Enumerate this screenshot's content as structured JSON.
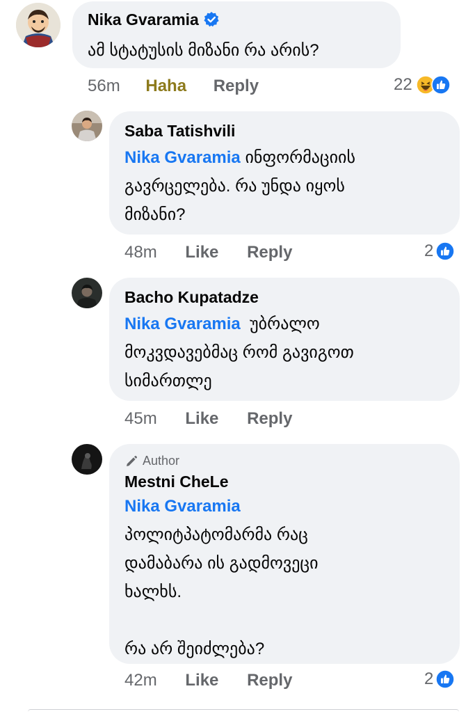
{
  "comments": [
    {
      "author": "Nika Gvaramia",
      "verified": true,
      "text": "ამ სტატუსის მიზანი რა არის?",
      "time": "56m",
      "reaction_action": "Haha",
      "reply": "Reply",
      "reaction_count": "22",
      "reaction_icons": [
        "haha-icon",
        "like-icon"
      ]
    },
    {
      "author": "Saba Tatishvili",
      "mention": "Nika Gvaramia",
      "text_lines": [
        "ინფორმაციის",
        "გავრცელება. რა უნდა იყოს",
        "მიზანი?"
      ],
      "time": "48m",
      "like": "Like",
      "reply": "Reply",
      "reaction_count": "2",
      "reaction_icons": [
        "like-icon"
      ]
    },
    {
      "author": "Bacho Kupatadze",
      "mention": "Nika Gvaramia",
      "text_lines": [
        "უბრალო",
        "მოკვდავებმაც რომ გავიგოთ",
        "სიმართლე"
      ],
      "time": "45m",
      "like": "Like",
      "reply": "Reply"
    },
    {
      "badge": "Author",
      "author": "Mestni CheLe",
      "mention": "Nika Gvaramia",
      "text_lines": [
        "პოლიტპატომარმა რაც",
        "დამაბარა ის გადმოვეცი",
        "ხალხს.",
        "",
        "რა არ შეიძლება?"
      ],
      "time": "42m",
      "like": "Like",
      "reply": "Reply",
      "reaction_count": "2",
      "reaction_icons": [
        "like-icon"
      ]
    }
  ],
  "colors": {
    "bubble": "#f0f2f5",
    "mention": "#1877f2",
    "meta": "#65676b",
    "haha_active": "#8d7a1c",
    "like_blue": "#1877f2",
    "haha_yellow": "#f7b928"
  }
}
